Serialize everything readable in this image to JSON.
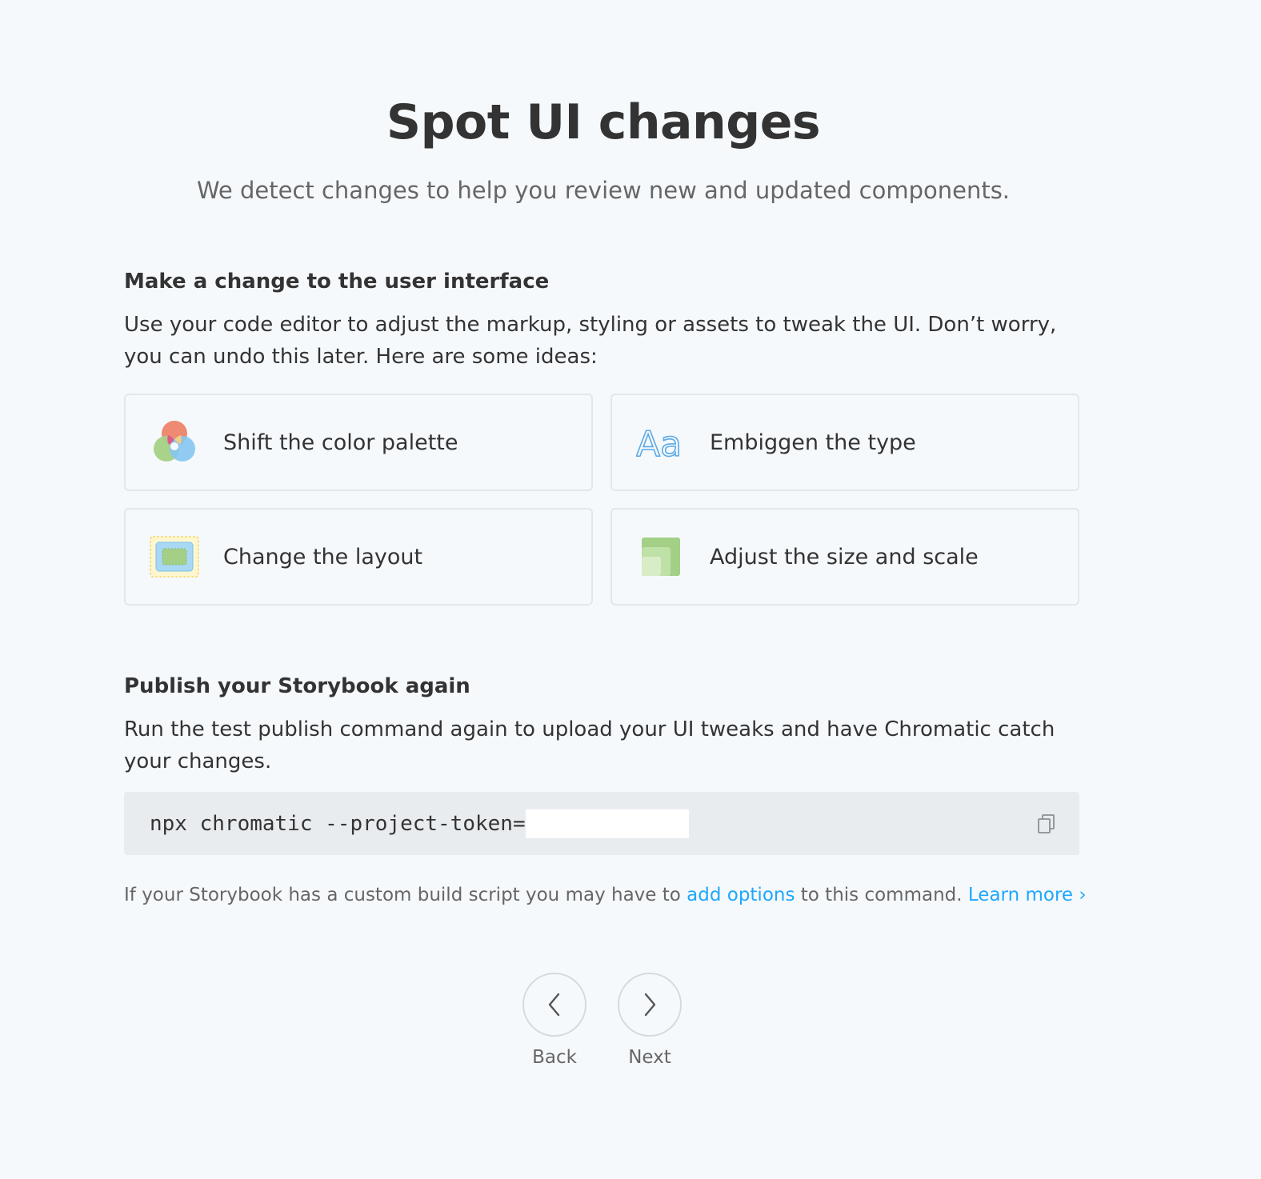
{
  "header": {
    "title": "Spot UI changes",
    "subtitle": "We detect changes to help you review new and updated components."
  },
  "step1": {
    "heading": "Make a change to the user interface",
    "text": "Use your code editor to adjust the markup, styling or assets to tweak the UI. Don’t worry, you can undo this later. Here are some ideas:",
    "ideas": [
      {
        "label": "Shift the color palette",
        "icon": "color-palette-icon"
      },
      {
        "label": "Embiggen the type",
        "icon": "typography-icon"
      },
      {
        "label": "Change the layout",
        "icon": "layout-icon"
      },
      {
        "label": "Adjust the size and scale",
        "icon": "size-scale-icon"
      }
    ]
  },
  "step2": {
    "heading": "Publish your Storybook again",
    "text": "Run the test publish command again to upload your UI tweaks and have Chromatic catch your changes.",
    "command": "npx chromatic --project-token=",
    "hint_prefix": "If your Storybook has a custom build script you may have to ",
    "hint_link": "add options",
    "hint_middle": " to this command. ",
    "hint_learn_more": "Learn more",
    "hint_chevron": "›"
  },
  "navigation": {
    "back_label": "Back",
    "next_label": "Next"
  },
  "colors": {
    "background": "#f6f9fc",
    "link": "#1ea7fd",
    "text": "#333333",
    "muted": "#666666"
  }
}
